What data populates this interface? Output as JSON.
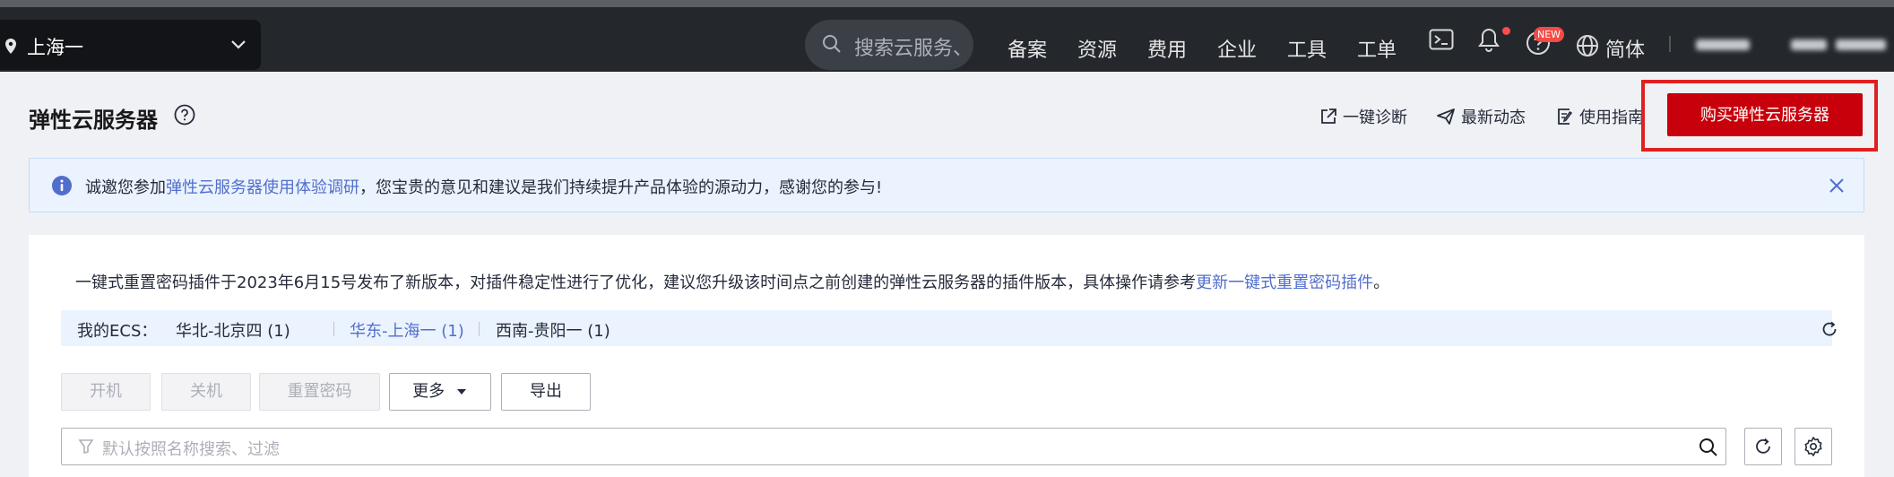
{
  "header": {
    "region": "上海一",
    "search_placeholder": "搜索云服务、",
    "nav": [
      "备案",
      "资源",
      "费用",
      "企业",
      "工具",
      "工单"
    ],
    "new_badge": "NEW",
    "language": "简体"
  },
  "page": {
    "title": "弹性云服务器",
    "actions": {
      "diagnose": "一键诊断",
      "news": "最新动态",
      "guide": "使用指南"
    },
    "buy_button": "购买弹性云服务器"
  },
  "notice": {
    "prefix": "诚邀您参加",
    "link": "弹性云服务器使用体验调研",
    "suffix": "，您宝贵的意见和建议是我们持续提升产品体验的源动力，感谢您的参与!"
  },
  "info": {
    "text": "一键式重置密码插件于2023年6月15号发布了新版本，对插件稳定性进行了优化，建议您升级该时间点之前创建的弹性云服务器的插件版本，具体操作请参考",
    "link": "更新一键式重置密码插件",
    "end": "。"
  },
  "ecs": {
    "label": "我的ECS：",
    "regions": [
      "华北-北京四 (1)",
      "华东-上海一 (1)",
      "西南-贵阳一 (1)"
    ]
  },
  "toolbar": {
    "start": "开机",
    "stop": "关机",
    "reset_password": "重置密码",
    "more": "更多",
    "export": "导出"
  },
  "filter": {
    "placeholder": "默认按照名称搜索、过滤"
  },
  "colors": {
    "topbar": "#24272c",
    "buy": "#c7000b",
    "link": "#526ecc",
    "highlight": "#e02020"
  }
}
